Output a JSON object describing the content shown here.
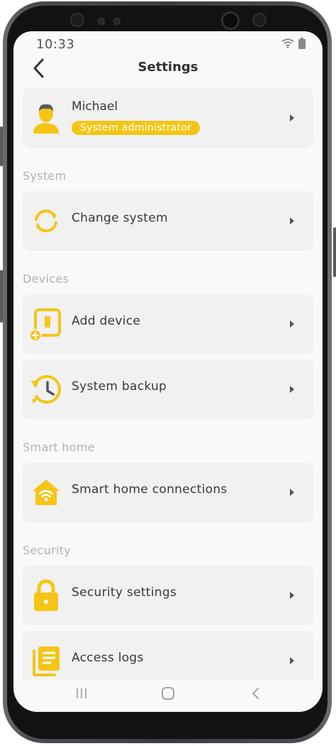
{
  "status_bar": {
    "time": "10:33"
  },
  "header": {
    "title": "Settings"
  },
  "user": {
    "name": "Michael",
    "role": "System administrator"
  },
  "sections": [
    {
      "title": "System",
      "items": [
        {
          "label": "Change system",
          "icon": "sync-arrows-icon"
        }
      ]
    },
    {
      "title": "Devices",
      "items": [
        {
          "label": "Add device",
          "icon": "add-device-icon"
        },
        {
          "label": "System backup",
          "icon": "clock-history-icon"
        }
      ]
    },
    {
      "title": "Smart home",
      "items": [
        {
          "label": "Smart home connections",
          "icon": "smart-home-icon"
        }
      ]
    },
    {
      "title": "Security",
      "items": [
        {
          "label": "Security settings",
          "icon": "padlock-icon"
        },
        {
          "label": "Access logs",
          "icon": "logs-icon"
        }
      ]
    }
  ],
  "colors": {
    "accent": "#f5c516",
    "background": "#f9f9f9",
    "card": "#f1f1f1",
    "section_text": "#b2b2b2",
    "text": "#383838"
  }
}
